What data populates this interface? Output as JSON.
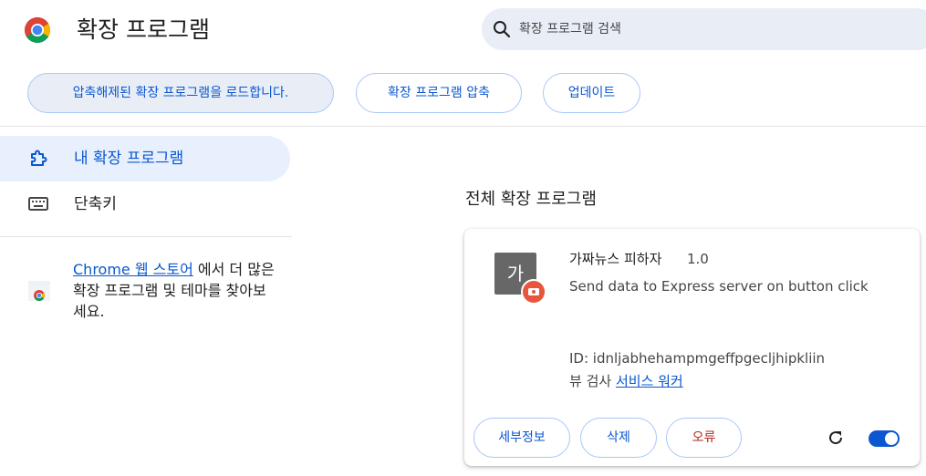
{
  "header": {
    "title": "확장 프로그램",
    "search_placeholder": "확장 프로그램 검색"
  },
  "toolbar": {
    "load_unpacked": "압축해제된 확장 프로그램을 로드합니다.",
    "pack_extension": "확장 프로그램 압축",
    "update": "업데이트"
  },
  "sidebar": {
    "items": [
      {
        "label": "내 확장 프로그램",
        "icon": "extension-icon",
        "active": true
      },
      {
        "label": "단축키",
        "icon": "keyboard-icon",
        "active": false
      }
    ],
    "store": {
      "link_text": "Chrome 웹 스토어",
      "text_after": " 에서 더 많은 확장 프로그램 및 테마를 찾아보세요."
    }
  },
  "main": {
    "section_title": "전체 확장 프로그램",
    "extension": {
      "icon_letter": "가",
      "name": "가짜뉴스 피하자",
      "version": "1.0",
      "description": "Send data to Express server on button click",
      "id_text": "ID: idnljabhehampmgeffpgecljhipkliin",
      "views_label": "뷰 검사 ",
      "views_link": "서비스 워커",
      "details_label": "세부정보",
      "remove_label": "삭제",
      "errors_label": "오류",
      "enabled": true
    }
  },
  "colors": {
    "accent": "#0b57d0",
    "active_nav_bg": "#e8f0fe",
    "error": "#b3261e",
    "badge": "#e8553c"
  }
}
